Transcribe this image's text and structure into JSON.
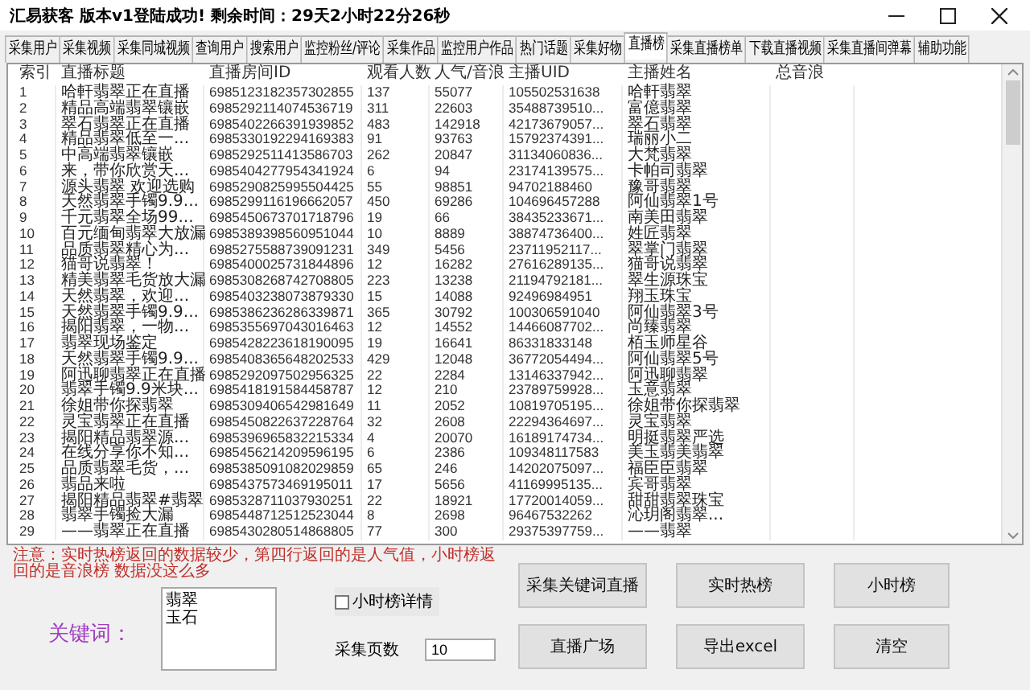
{
  "window": {
    "title": "汇易获客 版本v1登陆成功! 剩余时间：29天2小时22分26秒"
  },
  "tabs": [
    {
      "label": "采集用户",
      "selected": false
    },
    {
      "label": "采集视频",
      "selected": false
    },
    {
      "label": "采集同城视频",
      "selected": false
    },
    {
      "label": "查询用户",
      "selected": false
    },
    {
      "label": "搜索用户",
      "selected": false
    },
    {
      "label": "监控粉丝/评论",
      "selected": false
    },
    {
      "label": "采集作品",
      "selected": false
    },
    {
      "label": "监控用户作品",
      "selected": false
    },
    {
      "label": "热门话题",
      "selected": false
    },
    {
      "label": "采集好物",
      "selected": false
    },
    {
      "label": "直播榜",
      "selected": true
    },
    {
      "label": "采集直播榜单",
      "selected": false
    },
    {
      "label": "下载直播视频",
      "selected": false
    },
    {
      "label": "采集直播间弹幕",
      "selected": false
    },
    {
      "label": "辅助功能",
      "selected": false
    }
  ],
  "table": {
    "columns": [
      "索引",
      "直播标题",
      "直播房间ID",
      "观看人数",
      "人气/音浪",
      "主播UID",
      "主播姓名",
      "总音浪"
    ],
    "rows": [
      [
        "1",
        "哈軒翡翠正在直播",
        "6985123182357302855",
        "137",
        "55077",
        "105502531638",
        "哈軒翡翠"
      ],
      [
        "2",
        "精品高端翡翠镶嵌",
        "6985292114074536719",
        "311",
        "22603",
        "35488739510...",
        "富億翡翠"
      ],
      [
        "3",
        "翠石翡翠正在直播",
        "6985402266391939852",
        "483",
        "142918",
        "42173679057...",
        "翠石翡翠"
      ],
      [
        "4",
        "精品翡翠低至一...",
        "6985330192294169383",
        "91",
        "93763",
        "15792374391...",
        "瑞丽小二"
      ],
      [
        "5",
        "中高端翡翠镶嵌",
        "6985292511413586703",
        "262",
        "20847",
        "31134060836...",
        "大梵翡翠"
      ],
      [
        "6",
        "来，带你欣赏天...",
        "6985404277954341924",
        "6",
        "94",
        "23174139575...",
        "卡帕司翡翠"
      ],
      [
        "7",
        "源头翡翠 欢迎选购",
        "6985290825995504425",
        "55",
        "98851",
        "94702188460",
        "豫哥翡翠"
      ],
      [
        "8",
        "天然翡翠手镯9.9...",
        "6985299116196662057",
        "450",
        "69286",
        "104696457288",
        "阿仙翡翠1号"
      ],
      [
        "9",
        "千元翡翠全场99...",
        "6985450673701718796",
        "19",
        "66",
        "38435233671...",
        "南美田翡翠"
      ],
      [
        "10",
        "百元缅甸翡翠大放漏",
        "6985389398560951044",
        "10",
        "8889",
        "38874736400...",
        "姓匠翡翠"
      ],
      [
        "11",
        "品质翡翠精心为...",
        "6985275588739091231",
        "349",
        "5456",
        "23711952117...",
        "翠掌门翡翠"
      ],
      [
        "12",
        "猫哥说翡翠！",
        "6985400025731844896",
        "12",
        "16282",
        "27616289135...",
        "猫哥说翡翠"
      ],
      [
        "13",
        "精美翡翠毛货放大漏",
        "6985308268742708805",
        "223",
        "13238",
        "21194792181...",
        "翠生源珠宝"
      ],
      [
        "14",
        "天然翡翠，欢迎...",
        "6985403238073879330",
        "15",
        "14088",
        "92496984951",
        "翔玉珠宝"
      ],
      [
        "15",
        "天然翡翠手镯9.9...",
        "6985386236286339871",
        "365",
        "30792",
        "100306591040",
        "阿仙翡翠3号"
      ],
      [
        "16",
        "揭阳翡翠，一物...",
        "6985355697043016463",
        "12",
        "14552",
        "14466087702...",
        "尚臻翡翠"
      ],
      [
        "17",
        "翡翠现场鉴定",
        "6985428223618190095",
        "19",
        "16641",
        "86331833148",
        "栢玉师星谷"
      ],
      [
        "18",
        "天然翡翠手镯9.9...",
        "6985408365648202533",
        "429",
        "12048",
        "36772054494...",
        "阿仙翡翠5号"
      ],
      [
        "19",
        "阿迅聊翡翠正在直播",
        "6985292097502956325",
        "22",
        "2284",
        "13146337942...",
        "阿迅聊翡翠"
      ],
      [
        "20",
        "翡翠手镯9.9米块...",
        "6985418191584458787",
        "12",
        "210",
        "23789759928...",
        "玉意翡翠"
      ],
      [
        "21",
        "徐姐带你探翡翠",
        "6985309406542981649",
        "11",
        "2052",
        "10819705195...",
        "徐姐带你探翡翠"
      ],
      [
        "22",
        "灵宝翡翠正在直播",
        "6985450822637228764",
        "32",
        "2608",
        "22294364697...",
        "灵宝翡翠"
      ],
      [
        "23",
        "揭阳精品翡翠源...",
        "6985396965832215334",
        "4",
        "20070",
        "16189174734...",
        "明挺翡翠严选"
      ],
      [
        "24",
        "在线分享你不知...",
        "6985456214209596195",
        "6",
        "2386",
        "109348117583",
        "美玉翡美翡翠"
      ],
      [
        "25",
        "品质翡翠毛货，...",
        "6985385091082029859",
        "65",
        "246",
        "14202075097...",
        "福臣臣翡翠"
      ],
      [
        "26",
        "翡品来啦",
        "6985437573469195011",
        "17",
        "5656",
        "41169995135...",
        "宾哥翡翠"
      ],
      [
        "27",
        "揭阳精品翡翠#翡翠",
        "6985328711037930251",
        "22",
        "18921",
        "17720014059...",
        "甜甜翡翠珠宝"
      ],
      [
        "28",
        "翡翠手镯捡大漏",
        "6985448712512523044",
        "8",
        "2698",
        "96467532262",
        "沁玥阁翡翠..."
      ],
      [
        "29",
        "——翡翠正在直播",
        "6985430280514868805",
        "77",
        "300",
        "29375397759...",
        "——翡翠"
      ]
    ]
  },
  "notice": "注意：实时热榜返回的数据较少，第四行返回的是人气值，小时榜返回的是音浪榜   数据没这么多",
  "keyword": {
    "label": "关键词：",
    "lines": [
      "翡翠",
      "玉石"
    ]
  },
  "hourly_detail": {
    "label": "小时榜详情",
    "checked": false
  },
  "pages": {
    "label": "采集页数",
    "value": "10"
  },
  "buttons": [
    {
      "label": "采集关键词直播"
    },
    {
      "label": "实时热榜"
    },
    {
      "label": "小时榜"
    },
    {
      "label": "直播广场"
    },
    {
      "label": "导出excel"
    },
    {
      "label": "清空"
    }
  ]
}
